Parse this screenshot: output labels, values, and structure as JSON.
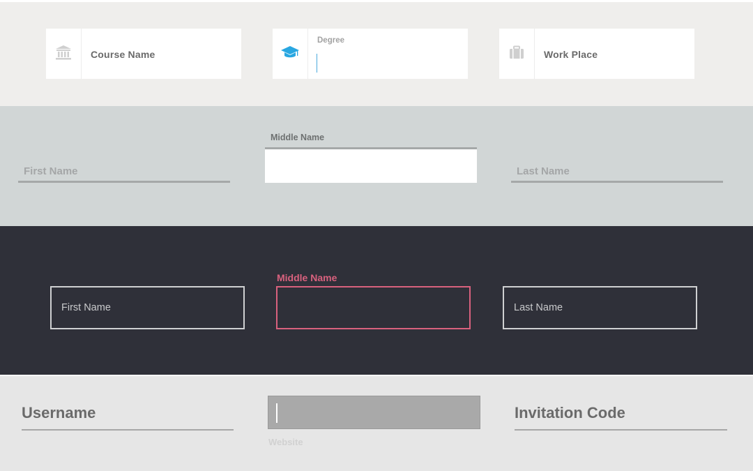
{
  "row1": {
    "course": {
      "label": "Course Name",
      "icon": "institution-icon"
    },
    "degree": {
      "label": "Degree",
      "icon": "graduation-cap-icon",
      "accent": "#29a7e1"
    },
    "work": {
      "label": "Work Place",
      "icon": "briefcase-icon"
    }
  },
  "row2": {
    "first": "First Name",
    "middle": "Middle Name",
    "last": "Last Name"
  },
  "row3": {
    "first": "First Name",
    "middle": "Middle Name",
    "last": "Last Name",
    "accent": "#d9617e"
  },
  "row4": {
    "username": "Username",
    "website": "Website",
    "invitation": "Invitation Code"
  }
}
